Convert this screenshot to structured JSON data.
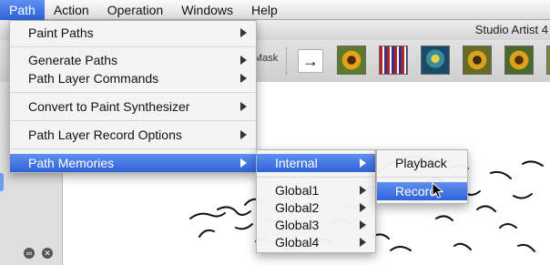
{
  "menubar": {
    "items": [
      "Path",
      "Action",
      "Operation",
      "Windows",
      "Help"
    ]
  },
  "app": {
    "title": "Studio Artist 4"
  },
  "toolbar": {
    "mask_label": "Mask",
    "arrow_symbol": "→"
  },
  "path_menu": {
    "items": [
      {
        "label": "Paint Paths"
      },
      {
        "label": "Generate Paths"
      },
      {
        "label": "Path Layer Commands"
      },
      {
        "label": "Convert to Paint Synthesizer"
      },
      {
        "label": "Path Layer Record Options"
      },
      {
        "label": "Path Memories"
      }
    ]
  },
  "memories_menu": {
    "items": [
      {
        "label": "Internal"
      },
      {
        "label": "Global1"
      },
      {
        "label": "Global2"
      },
      {
        "label": "Global3"
      },
      {
        "label": "Global4"
      }
    ]
  },
  "internal_menu": {
    "items": [
      {
        "label": "Playback"
      },
      {
        "label": "Record"
      }
    ]
  },
  "colors": {
    "highlight": "#2f63d8",
    "menu_bg": "#f4f4f4"
  },
  "icons": [
    "submenu-arrow-icon",
    "right-arrow-icon",
    "mouse-pointer-icon",
    "close-icon",
    "link-icon"
  ]
}
